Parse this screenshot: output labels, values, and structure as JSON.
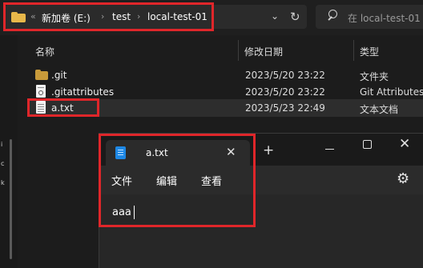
{
  "addressbar": {
    "chevron": "«",
    "path": [
      {
        "label": "新加卷 (E:)"
      },
      {
        "label": "test"
      },
      {
        "label": "local-test-01"
      }
    ],
    "separator": "›",
    "dropdown_icon": "chevron-down-icon",
    "refresh_icon": "refresh-icon"
  },
  "search": {
    "placeholder": "在 local-test-01"
  },
  "left_strip_letters": [
    "i",
    "c",
    "k"
  ],
  "columns": {
    "name": "名称",
    "date": "修改日期",
    "type": "类型"
  },
  "files": [
    {
      "name": ".git",
      "date": "2023/5/20 23:22",
      "type": "文件夹",
      "icon": "folder-icon"
    },
    {
      "name": ".gitattributes",
      "date": "2023/5/20 23:22",
      "type": "Git Attributes",
      "icon": "settings-file-icon"
    },
    {
      "name": "a.txt",
      "date": "2023/5/23 22:49",
      "type": "文本文档",
      "icon": "text-file-icon",
      "selected": true
    }
  ],
  "notepad": {
    "tab_title": "a.txt",
    "menus": [
      "文件",
      "编辑",
      "查看"
    ],
    "content": "aaa"
  },
  "colors": {
    "highlight": "#e0262a",
    "folder": "#e8b84a",
    "notepad_icon": "#1e88e5"
  }
}
